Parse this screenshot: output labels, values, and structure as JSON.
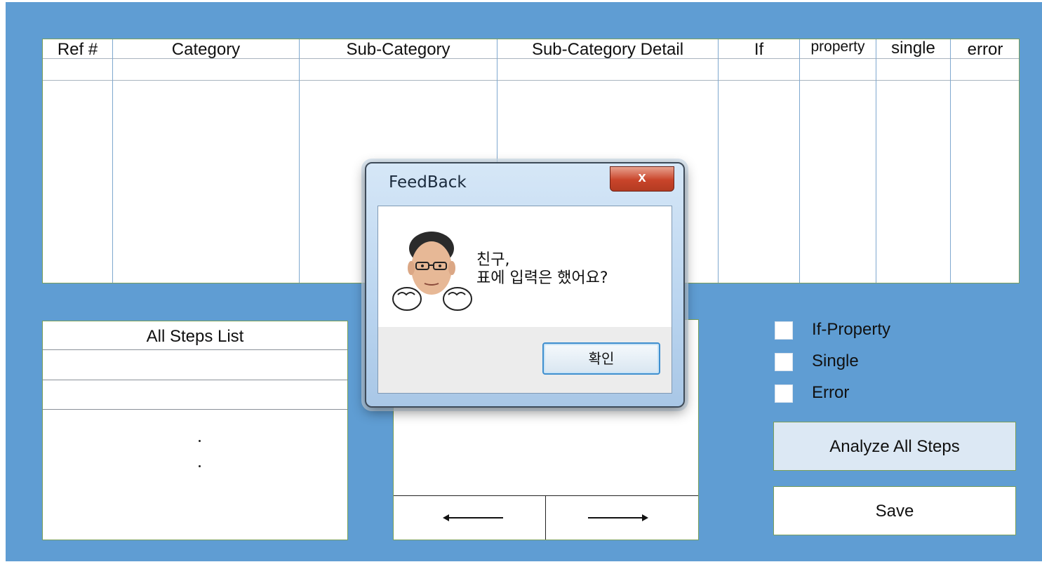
{
  "table": {
    "columns": [
      "Ref #",
      "Category",
      "Sub-Category",
      "Sub-Category Detail",
      "If",
      "property",
      "single",
      "error"
    ]
  },
  "steps_list": {
    "title": "All Steps List",
    "ellipsis": [
      ".",
      "."
    ]
  },
  "options": {
    "checkboxes": [
      {
        "label": "If-Property",
        "checked": false
      },
      {
        "label": "Single",
        "checked": false
      },
      {
        "label": "Error",
        "checked": false
      }
    ],
    "analyze_label": "Analyze All Steps",
    "save_label": "Save"
  },
  "navigation": {
    "prev_icon": "arrow-left-icon",
    "next_icon": "arrow-right-icon"
  },
  "dialog": {
    "title": "FeedBack",
    "close_symbol": "x",
    "message_line1": "친구,",
    "message_line2": "표에 입력은 했어요?",
    "ok_label": "확인"
  },
  "colors": {
    "background": "#5f9dd3",
    "panel_border": "#7a9f5a",
    "analyze_button": "#dce8f4",
    "close_button": "#c9442a"
  }
}
